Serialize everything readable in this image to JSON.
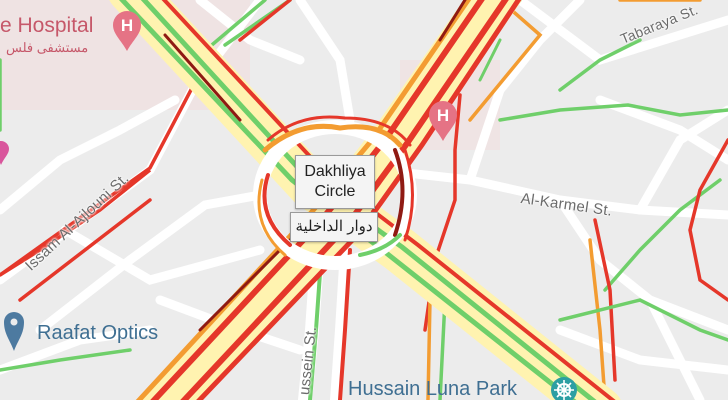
{
  "map": {
    "places": {
      "hospital_top_en": "e Hospital",
      "hospital_top_ar": "مستشفى فلس",
      "raafat_optics": "Raafat Optics",
      "hussain_luna_park": "Hussain Luna Park"
    },
    "streets": {
      "tabaraya": "Tabaraya St.",
      "issam_ajlouni": "Issam Al-Ajlouni St.",
      "al_karmel": "Al-Karmel St.",
      "hussein": "ussein St."
    },
    "circle": {
      "name_en_line1": "Dakhliya",
      "name_en_line2": "Circle",
      "name_ar": "دوار الداخلية"
    },
    "colors": {
      "background": "#ececec",
      "road": "#ffffff",
      "traffic_free": "#6fcf6a",
      "traffic_moderate": "#f39c31",
      "traffic_heavy": "#e5372a",
      "traffic_severe": "#8f1a13",
      "hospital_accent": "#e57385",
      "poi_blue": "#3f6f92"
    },
    "icons": [
      "hospital-icon",
      "place-pin-icon",
      "park-icon"
    ]
  }
}
